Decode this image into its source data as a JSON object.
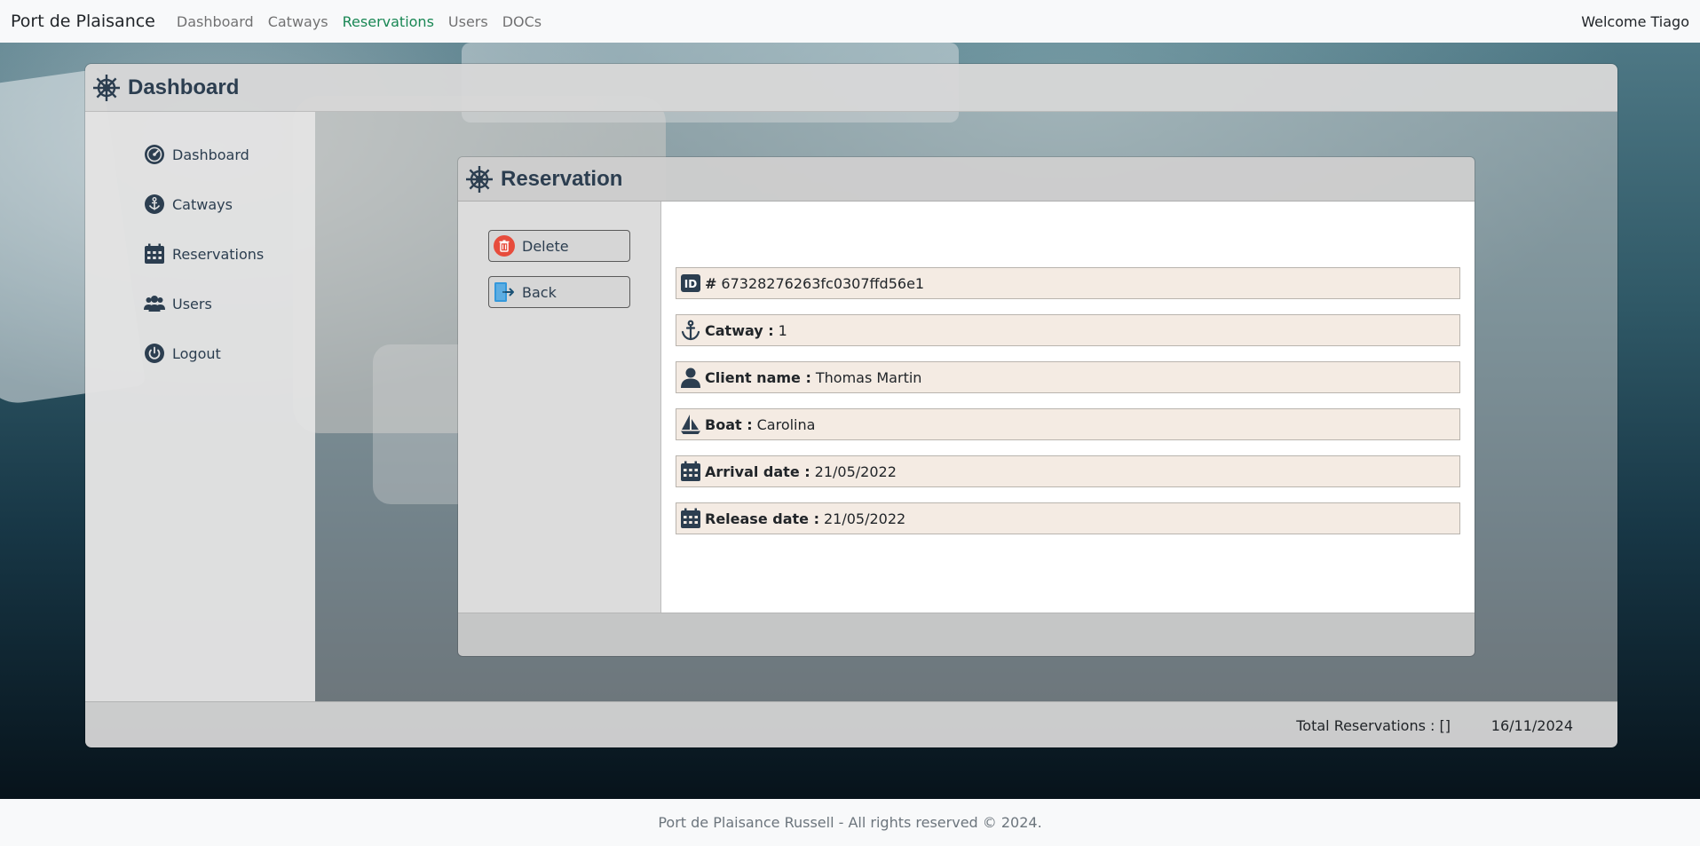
{
  "navbar": {
    "brand": "Port de Plaisance",
    "links": [
      "Dashboard",
      "Catways",
      "Reservations",
      "Users",
      "DOCs"
    ],
    "active": "Reservations",
    "welcome": "Welcome Tiago"
  },
  "dashboard": {
    "title": "Dashboard",
    "sidebar": [
      {
        "label": "Dashboard",
        "icon": "dashboard-gauge-icon"
      },
      {
        "label": "Catways",
        "icon": "anchor-icon"
      },
      {
        "label": "Reservations",
        "icon": "calendar-icon"
      },
      {
        "label": "Users",
        "icon": "users-icon"
      },
      {
        "label": "Logout",
        "icon": "power-icon"
      }
    ],
    "total_reservations": "Total Reservations : []",
    "date": "16/11/2024"
  },
  "reservation": {
    "title": "Reservation",
    "delete_label": "Delete",
    "back_label": "Back",
    "id_label": "#",
    "id_value": "67328276263fc0307ffd56e1",
    "catway_label": "Catway :",
    "catway_value": "1",
    "client_label": "Client name :",
    "client_value": "Thomas Martin",
    "boat_label": "Boat :",
    "boat_value": "Carolina",
    "arrival_label": "Arrival date :",
    "arrival_value": "21/05/2022",
    "release_label": "Release date :",
    "release_value": "21/05/2022"
  },
  "footer": {
    "text": "Port de Plaisance Russell - All rights reserved © 2024."
  },
  "colors": {
    "active_link": "#198754",
    "heading": "#2c3e50",
    "row_bg": "#f4ebe3",
    "delete_icon": "#e74c3c",
    "back_icon": "#3498db"
  }
}
